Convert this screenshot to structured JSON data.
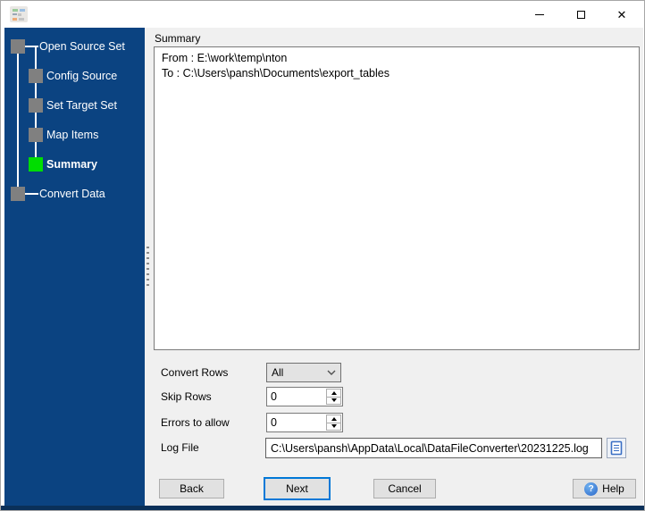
{
  "window": {
    "glyphs": {
      "close": "✕",
      "help_icon": "?"
    },
    "icons": [
      "app-grid-icon",
      "minimize-icon",
      "maximize-icon",
      "close-icon"
    ]
  },
  "colors": {
    "sidebar_background": "#0B4381",
    "step_square": "#808080",
    "active_step_square": "#00DD00",
    "sidebar_text": "#FFFFFF",
    "focus_border": "#0078D7",
    "panel_background": "#F0F0F0",
    "bottom_border": "#0A3059"
  },
  "sidebar": {
    "active_step": "Summary",
    "steps": [
      {
        "label": "Open Source Set"
      },
      {
        "label": "Config Source"
      },
      {
        "label": "Set Target Set"
      },
      {
        "label": "Map Items"
      },
      {
        "label": "Summary"
      },
      {
        "label": "Convert Data"
      }
    ]
  },
  "main": {
    "header": "Summary",
    "summary": {
      "line_from": "From : E:\\work\\temp\\nton",
      "line_to": "To : C:\\Users\\pansh\\Documents\\export_tables"
    },
    "fields": {
      "convert_rows": {
        "label": "Convert Rows",
        "value": "All"
      },
      "skip_rows": {
        "label": "Skip Rows",
        "value": "0"
      },
      "errors_to_allow": {
        "label": "Errors to allow",
        "value": "0"
      },
      "log_file": {
        "label": "Log File",
        "value": "C:\\Users\\pansh\\AppData\\Local\\DataFileConverter\\20231225.log"
      }
    },
    "buttons": {
      "back": "Back",
      "next": "Next",
      "cancel": "Cancel",
      "help": "Help"
    }
  }
}
